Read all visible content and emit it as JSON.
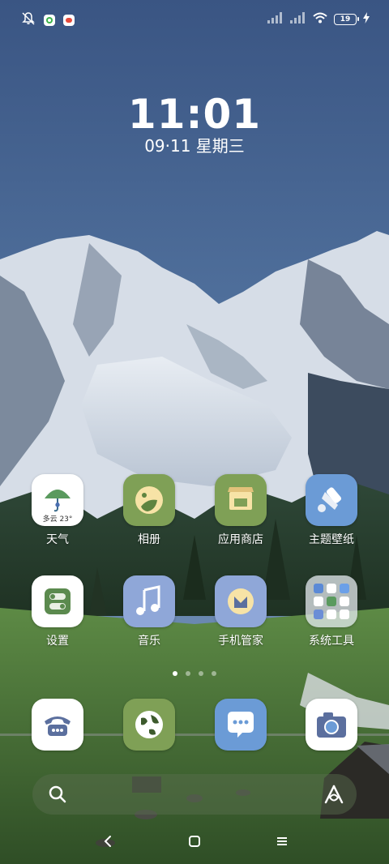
{
  "status_bar": {
    "icons_left": [
      "bell-off-icon",
      "green-app-notification-icon",
      "red-app-notification-icon"
    ],
    "signal": [
      "signal-1-icon",
      "signal-2-icon"
    ],
    "wifi": "wifi-icon",
    "battery_level": "19",
    "charging": "charging-bolt-icon"
  },
  "clock": {
    "time": "11:01",
    "date": "09·11 星期三"
  },
  "weather": {
    "temp": "多云 23°"
  },
  "apps": {
    "row1": [
      {
        "label": "天气",
        "icon": "weather-umbrella-icon"
      },
      {
        "label": "相册",
        "icon": "gallery-icon"
      },
      {
        "label": "应用商店",
        "icon": "app-store-icon"
      },
      {
        "label": "主题壁纸",
        "icon": "themes-brush-icon"
      }
    ],
    "row2": [
      {
        "label": "设置",
        "icon": "settings-toggle-icon"
      },
      {
        "label": "音乐",
        "icon": "music-note-icon"
      },
      {
        "label": "手机管家",
        "icon": "security-manager-icon"
      },
      {
        "label": "系统工具",
        "icon": "system-tools-folder-icon"
      }
    ]
  },
  "page_indicator": {
    "count": 4,
    "active": 1
  },
  "dock": [
    {
      "name": "phone",
      "icon": "phone-icon"
    },
    {
      "name": "browser",
      "icon": "browser-globe-icon"
    },
    {
      "name": "messages",
      "icon": "messages-icon"
    },
    {
      "name": "camera",
      "icon": "camera-icon"
    }
  ],
  "search": {
    "placeholder": "",
    "icon": "search-icon",
    "assistant_icon": "ai-assistant-icon"
  },
  "nav": {
    "back": "back-icon",
    "home": "home-icon",
    "recents": "recents-icon"
  },
  "colors": {
    "sky_top": "#3d5a86",
    "sky_bottom": "#5a7ba6",
    "grass": "#4a7a3a",
    "icon_green": "#7fa056",
    "icon_blue": "#6b9bd6",
    "icon_periwinkle": "#8fa7d8",
    "icon_white": "#ffffff"
  }
}
